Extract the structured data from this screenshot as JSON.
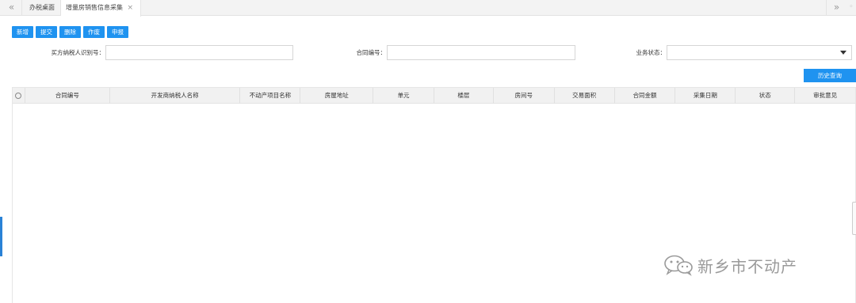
{
  "tabs": {
    "prev_icon": "«",
    "next_icon": "»",
    "items": [
      {
        "label": "办税桌面"
      },
      {
        "label": "增量房销售信息采集",
        "close": "×"
      }
    ]
  },
  "toolbar": {
    "add": "新增",
    "submit": "提交",
    "delete": "删除",
    "void": "作废",
    "declare": "申报"
  },
  "form": {
    "buyer_id_label": "买方纳税人识别号：",
    "buyer_id_value": "",
    "contract_no_label": "合同编号：",
    "contract_no_value": "",
    "status_label": "业务状态：",
    "status_value": ""
  },
  "history_button": "历史查询",
  "table": {
    "columns": [
      "合同编号",
      "开发商纳税人名称",
      "不动产项目名称",
      "房屋地址",
      "单元",
      "楼层",
      "房间号",
      "交易面积",
      "合同金额",
      "采集日期",
      "状态",
      "审批意见"
    ],
    "rows": []
  },
  "watermark": {
    "text": "新乡市不动产",
    "icon": "wechat-icon"
  },
  "colors": {
    "primary": "#1f93f0",
    "header_bg": "#f1f1f1"
  }
}
